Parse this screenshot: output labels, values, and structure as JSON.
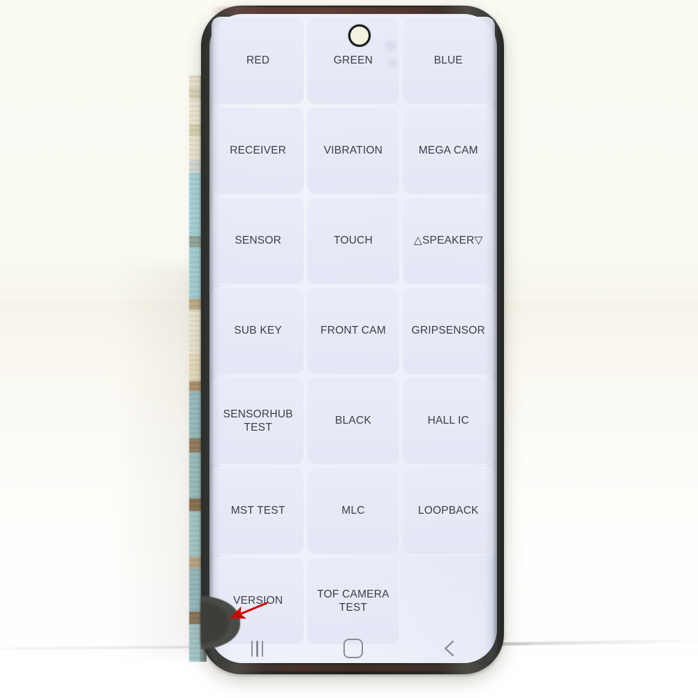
{
  "scene": {
    "subject": "smartphone-diagnostic-screen",
    "background_color": "#fbfbf4",
    "table_color": "#f6f3e9"
  },
  "phone": {
    "body_color": "#242624",
    "screen_tint": "#eceef9",
    "camera": {
      "name": "punch-hole-front-camera"
    }
  },
  "diagnostic_menu": {
    "columns": 3,
    "text_color": "#3b3d48",
    "button_color": "#e7eaf7",
    "rows": [
      [
        {
          "label": "RED",
          "name": "test-button-red"
        },
        {
          "label": "GREEN",
          "name": "test-button-green"
        },
        {
          "label": "BLUE",
          "name": "test-button-blue"
        }
      ],
      [
        {
          "label": "RECEIVER",
          "name": "test-button-receiver"
        },
        {
          "label": "VIBRATION",
          "name": "test-button-vibration"
        },
        {
          "label": "MEGA CAM",
          "name": "test-button-mega-cam"
        }
      ],
      [
        {
          "label": "SENSOR",
          "name": "test-button-sensor"
        },
        {
          "label": "TOUCH",
          "name": "test-button-touch"
        },
        {
          "label": "△SPEAKER▽",
          "name": "test-button-speaker"
        }
      ],
      [
        {
          "label": "SUB KEY",
          "name": "test-button-sub-key"
        },
        {
          "label": "FRONT CAM",
          "name": "test-button-front-cam"
        },
        {
          "label": "GRIPSENSOR",
          "name": "test-button-gripsensor"
        }
      ],
      [
        {
          "label": "SENSORHUB TEST",
          "name": "test-button-sensorhub-test"
        },
        {
          "label": "BLACK",
          "name": "test-button-black"
        },
        {
          "label": "HALL IC",
          "name": "test-button-hall-ic"
        }
      ],
      [
        {
          "label": "MST TEST",
          "name": "test-button-mst-test"
        },
        {
          "label": "MLC",
          "name": "test-button-mlc"
        },
        {
          "label": "LOOPBACK",
          "name": "test-button-loopback"
        }
      ],
      [
        {
          "label": "VERSION",
          "name": "test-button-version"
        },
        {
          "label": "TOF CAMERA TEST",
          "name": "test-button-tof-camera-test"
        },
        {
          "label": "",
          "name": "test-button-empty"
        }
      ]
    ]
  },
  "navigation_bar": {
    "icon_color": "#8a8d99",
    "buttons": [
      {
        "name": "recents-icon",
        "glyph": "|||"
      },
      {
        "name": "home-icon",
        "glyph": "▢"
      },
      {
        "name": "back-icon",
        "glyph": "‹"
      }
    ]
  },
  "annotation": {
    "arrow_color": "#d40000",
    "points_at": "display-defect-dark-blob",
    "defect_color": "#4a4a46"
  }
}
